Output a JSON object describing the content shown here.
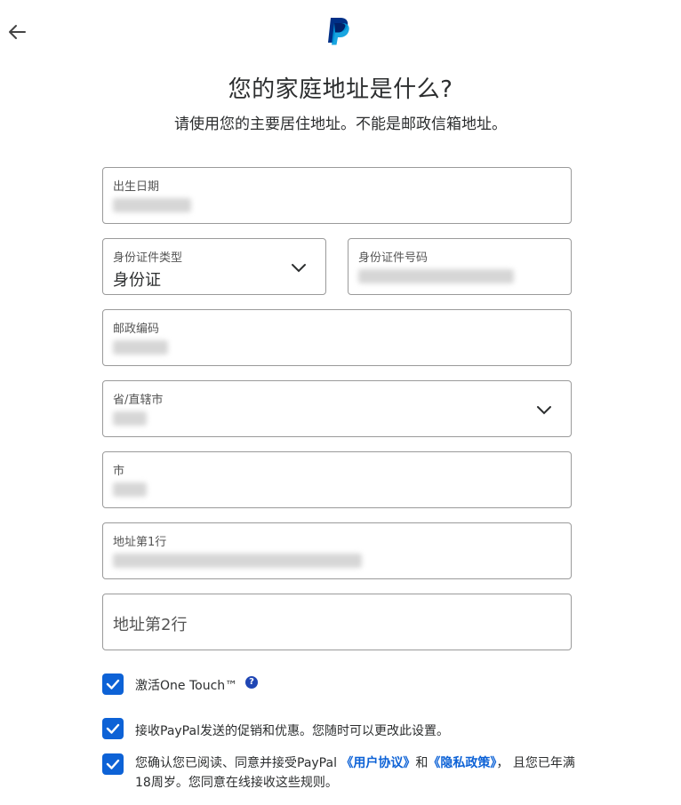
{
  "header": {
    "back_icon": "arrow-left-icon",
    "logo_icon": "paypal-logo-icon"
  },
  "title": "您的家庭地址是什么?",
  "subtitle": "请使用您的主要居住地址。不能是邮政信箱地址。",
  "fields": {
    "dob": {
      "label": "出生日期"
    },
    "id_type": {
      "label": "身份证件类型",
      "value": "身份证"
    },
    "id_number": {
      "label": "身份证件号码"
    },
    "postal_code": {
      "label": "邮政编码"
    },
    "province": {
      "label": "省/直辖市"
    },
    "city": {
      "label": "市"
    },
    "address1": {
      "label": "地址第1行"
    },
    "address2": {
      "placeholder": "地址第2行"
    }
  },
  "checkboxes": {
    "one_touch": {
      "label": "激活One Touch™",
      "checked": true
    },
    "promotions": {
      "label": "接收PayPal发送的促销和优惠。您随时可以更改此设置。",
      "checked": true
    },
    "terms": {
      "checked": true,
      "text_1": "您确认您已阅读、同意并接受PayPal ",
      "user_agreement": "《用户协议》",
      "and": "和",
      "privacy_policy": "《隐私政策》",
      "text_2": "， 且您已年满18周岁。您同意在线接收这些规则。"
    }
  },
  "colors": {
    "accent": "#0d62d6",
    "logo_dark": "#003087",
    "logo_light": "#009cde"
  }
}
